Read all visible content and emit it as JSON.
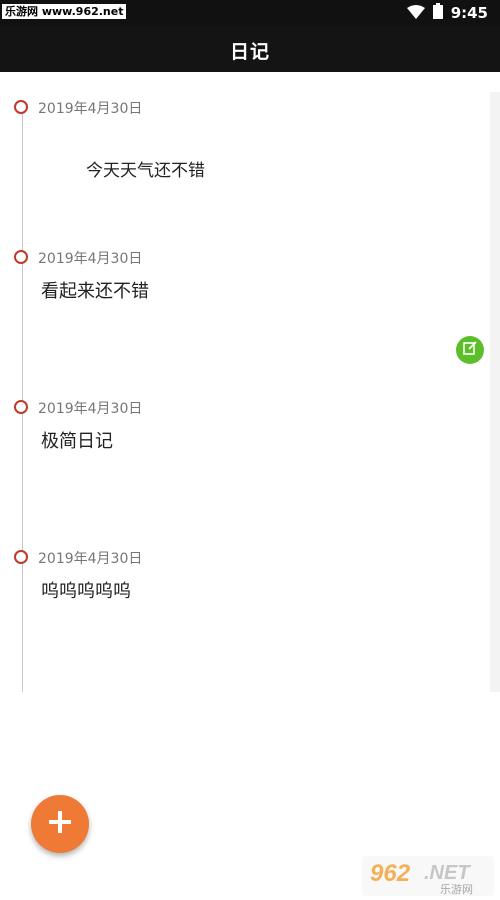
{
  "status_bar": {
    "watermark": "乐游网 www.962.net",
    "time": "9:45",
    "wifi_icon": "wifi-icon",
    "battery_icon": "battery-icon"
  },
  "app_bar": {
    "title": "日记"
  },
  "entries": [
    {
      "date": "2019年4月30日",
      "text": "今天天气还不错"
    },
    {
      "date": "2019年4月30日",
      "text": "看起来还不错"
    },
    {
      "date": "2019年4月30日",
      "text": "极简日记"
    },
    {
      "date": "2019年4月30日",
      "text": "呜呜呜呜呜"
    }
  ],
  "edit_button": {
    "icon": "edit-icon",
    "color": "#5cbf2a"
  },
  "add_button": {
    "icon": "plus-icon",
    "color": "#ef7a35"
  },
  "timeline_dot_color": "#c0392b",
  "bottom_watermark": {
    "brand": "962.NET",
    "subtitle": "乐游网"
  }
}
